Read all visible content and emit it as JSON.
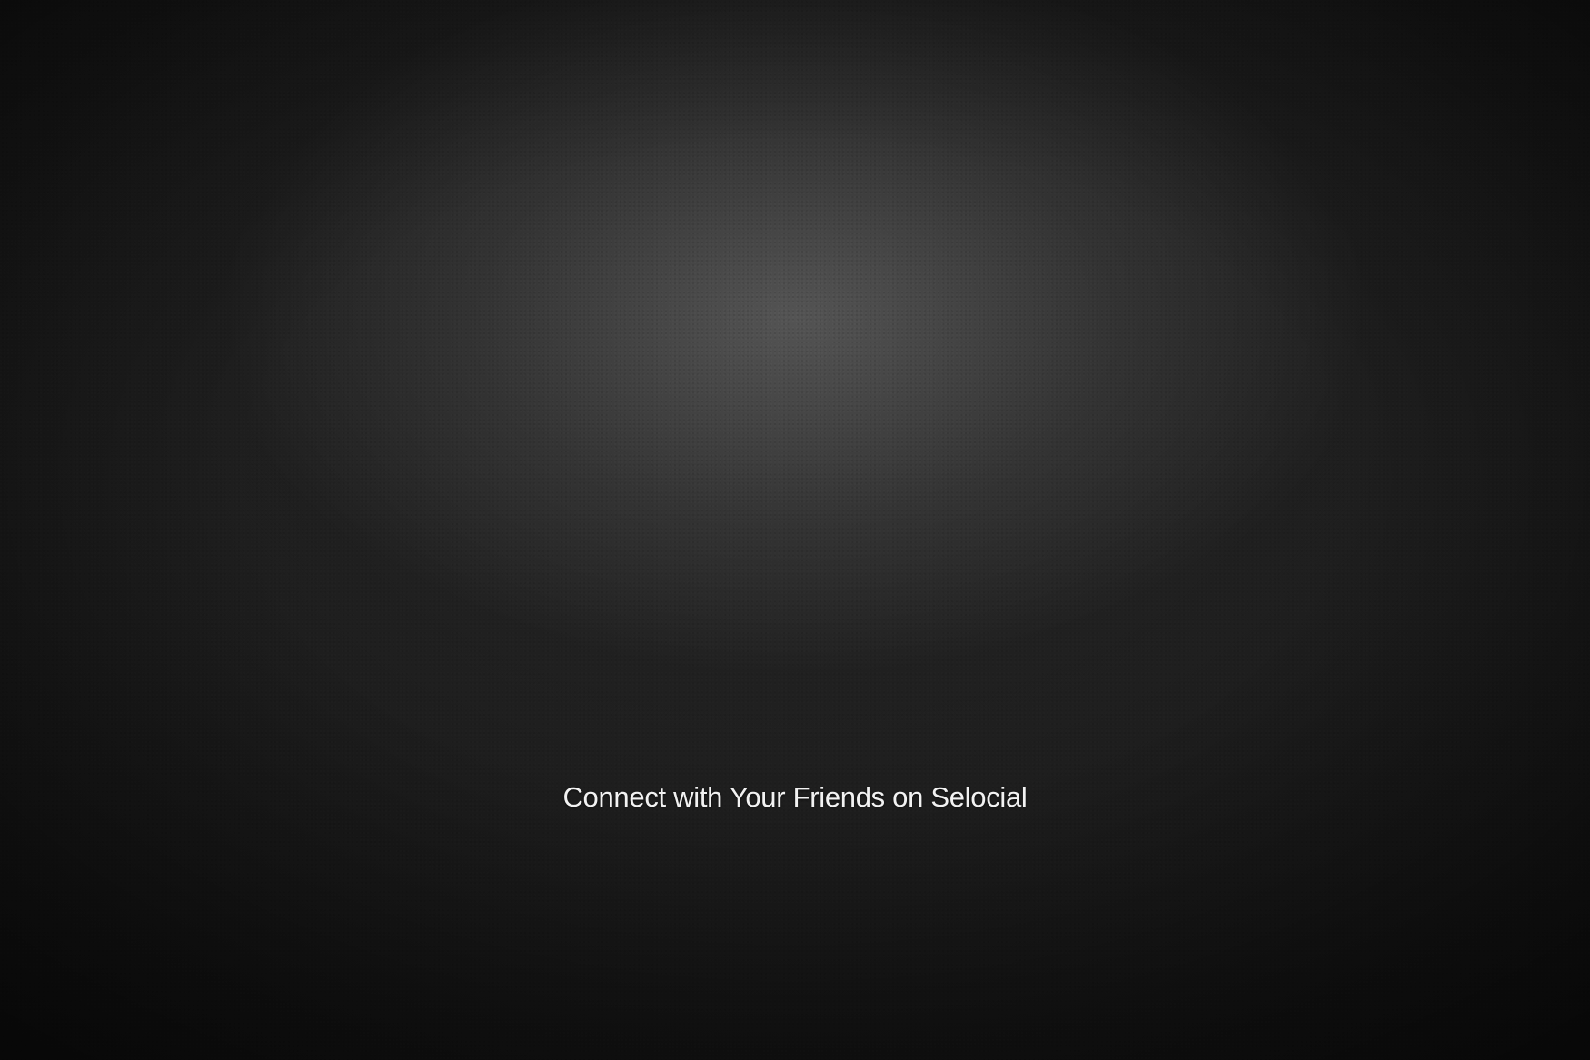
{
  "page": {
    "tagline": "Connect with Your Friends on Selocial"
  },
  "colors": {
    "background": "#0c0c0c",
    "text": "#f2f2f2"
  }
}
